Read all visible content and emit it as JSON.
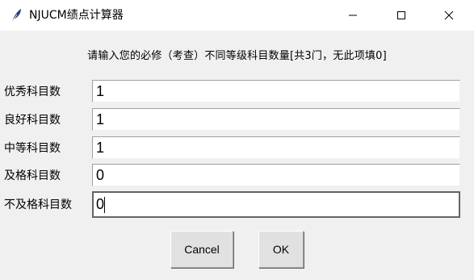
{
  "window": {
    "title": "NJUCM绩点计算器",
    "icon": "feather-icon",
    "controls": [
      "minimize-icon",
      "maximize-icon",
      "close-icon"
    ]
  },
  "prompt": "请输入您的必修（考查）不同等级科目数量[共3门，无此项填0]",
  "fields": [
    {
      "label": "优秀科目数",
      "value": "1"
    },
    {
      "label": "良好科目数",
      "value": "1"
    },
    {
      "label": "中等科目数",
      "value": "1"
    },
    {
      "label": "及格科目数",
      "value": "0"
    },
    {
      "label": "不及格科目数",
      "value": "0"
    }
  ],
  "buttons": {
    "cancel": "Cancel",
    "ok": "OK"
  }
}
